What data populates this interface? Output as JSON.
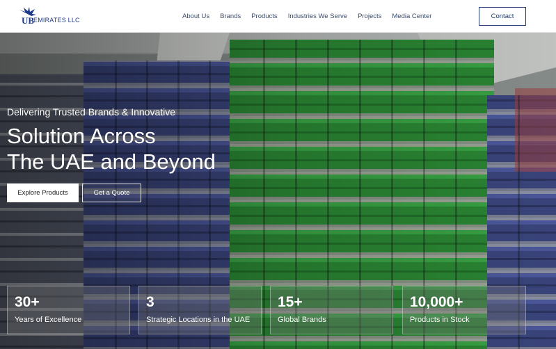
{
  "header": {
    "logo_mark": "UB",
    "logo_text": "EMIRATES LLC",
    "nav": [
      "About Us",
      "Brands",
      "Products",
      "Industries We Serve",
      "Projects",
      "Media Center"
    ],
    "contact_label": "Contact"
  },
  "hero": {
    "subtitle": "Delivering Trusted Brands & Innovative",
    "title_line1": "Solution Across",
    "title_line2": "The UAE and Beyond",
    "explore_label": "Explore Products",
    "quote_label": "Get a Quote"
  },
  "stats": [
    {
      "value": "30+",
      "label": "Years of Excellence"
    },
    {
      "value": "3",
      "label": "Strategic Locations in the UAE"
    },
    {
      "value": "15+",
      "label": "Global Brands"
    },
    {
      "value": "10,000+",
      "label": "Products in Stock"
    }
  ],
  "colors": {
    "brand": "#1f3a8a",
    "nav_text": "#3b4c6b",
    "cable_green": "#2f9a3a",
    "cable_blue": "#3f4c8a"
  }
}
